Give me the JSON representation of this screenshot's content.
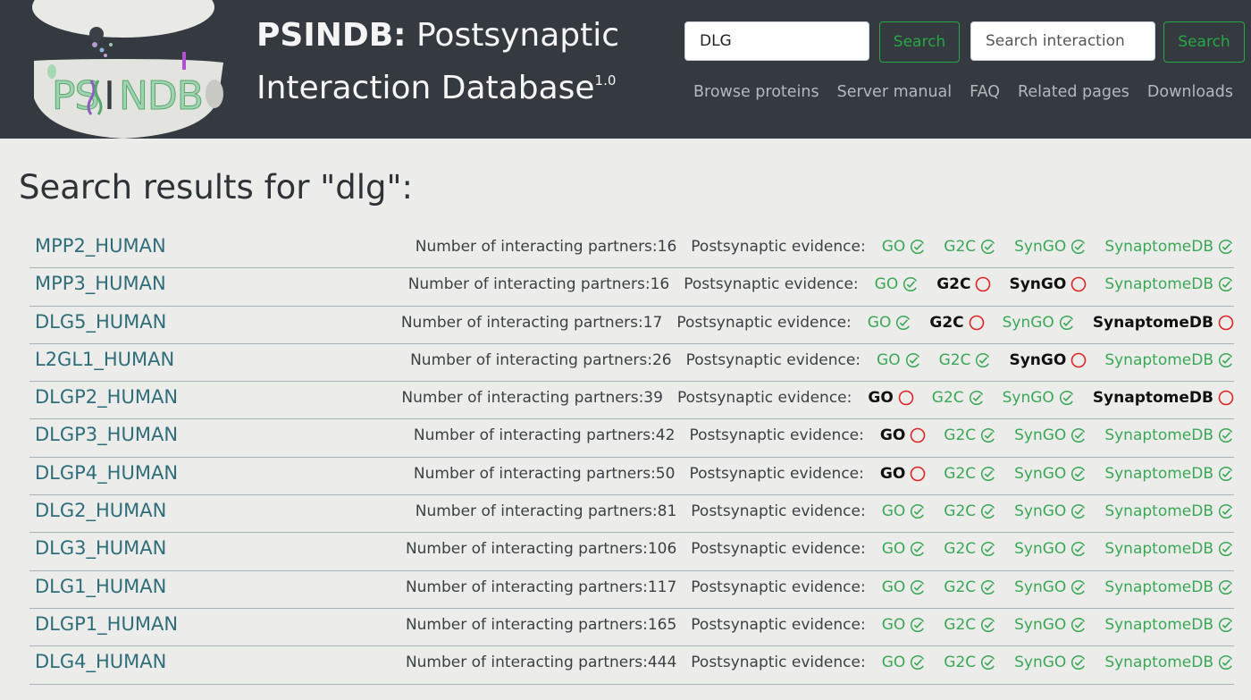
{
  "header": {
    "title_bold": "PSINDB:",
    "title_rest": " Postsynaptic",
    "title_line2": "Interaction Database",
    "version": "1.0",
    "search": {
      "value": "DLG",
      "button": "Search"
    },
    "search_interaction": {
      "placeholder": "Search interaction",
      "button": "Search"
    },
    "nav": [
      "Browse proteins",
      "Server manual",
      "FAQ",
      "Related pages",
      "Downloads"
    ]
  },
  "heading": "Search results for \"dlg\":",
  "labels": {
    "partners": "Number of interacting partners: ",
    "evidence": "Postsynaptic evidence:"
  },
  "evidence_sources": [
    "GO",
    "G2C",
    "SynGO",
    "SynaptomeDB"
  ],
  "colors": {
    "header_bg": "#343a40",
    "page_bg": "#ecedea",
    "accent_green": "#28a745",
    "link_teal": "#2e6d79",
    "negative_red": "#e02424"
  },
  "results": [
    {
      "name": "MPP2_HUMAN",
      "partners": "16",
      "evidence": [
        true,
        true,
        true,
        true
      ]
    },
    {
      "name": "MPP3_HUMAN",
      "partners": "16",
      "evidence": [
        true,
        false,
        false,
        true
      ]
    },
    {
      "name": "DLG5_HUMAN",
      "partners": "17",
      "evidence": [
        true,
        false,
        true,
        false
      ]
    },
    {
      "name": "L2GL1_HUMAN",
      "partners": "26",
      "evidence": [
        true,
        true,
        false,
        true
      ]
    },
    {
      "name": "DLGP2_HUMAN",
      "partners": "39",
      "evidence": [
        false,
        true,
        true,
        false
      ]
    },
    {
      "name": "DLGP3_HUMAN",
      "partners": "42",
      "evidence": [
        false,
        true,
        true,
        true
      ]
    },
    {
      "name": "DLGP4_HUMAN",
      "partners": "50",
      "evidence": [
        false,
        true,
        true,
        true
      ]
    },
    {
      "name": "DLG2_HUMAN",
      "partners": "81",
      "evidence": [
        true,
        true,
        true,
        true
      ]
    },
    {
      "name": "DLG3_HUMAN",
      "partners": "106",
      "evidence": [
        true,
        true,
        true,
        true
      ]
    },
    {
      "name": "DLG1_HUMAN",
      "partners": "117",
      "evidence": [
        true,
        true,
        true,
        true
      ]
    },
    {
      "name": "DLGP1_HUMAN",
      "partners": "165",
      "evidence": [
        true,
        true,
        true,
        true
      ]
    },
    {
      "name": "DLG4_HUMAN",
      "partners": "444",
      "evidence": [
        true,
        true,
        true,
        true
      ]
    }
  ]
}
